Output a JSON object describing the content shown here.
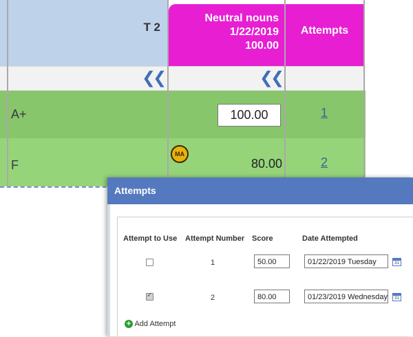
{
  "gradebook": {
    "columns": {
      "t2_label": "T 2",
      "neutral_nouns": {
        "title": "Neutral nouns",
        "date": "1/22/2019",
        "points": "100.00"
      },
      "attempts_label": "Attempts"
    },
    "collapse_icon": "double-chevron-left",
    "rows": [
      {
        "grade": "A+",
        "score": "100.00",
        "attempts": "1",
        "editable": true
      },
      {
        "grade": "F",
        "score": "80.00",
        "attempts": "2",
        "badge": "MA"
      }
    ]
  },
  "modal": {
    "title": "Attempts",
    "headers": {
      "use": "Attempt to Use",
      "number": "Attempt Number",
      "score": "Score",
      "date": "Date Attempted"
    },
    "attempts": [
      {
        "checked": false,
        "number": "1",
        "score": "50.00",
        "date": "01/22/2019 Tuesday"
      },
      {
        "checked": true,
        "number": "2",
        "score": "80.00",
        "date": "01/23/2019 Wednesday"
      }
    ],
    "calendar_day": "31",
    "add_label": "Add Attempt"
  },
  "colors": {
    "header_pink": "#e81ed3",
    "header_blue": "#bed3ea",
    "row_green": "#88c66c",
    "modal_blue": "#5479bf"
  }
}
